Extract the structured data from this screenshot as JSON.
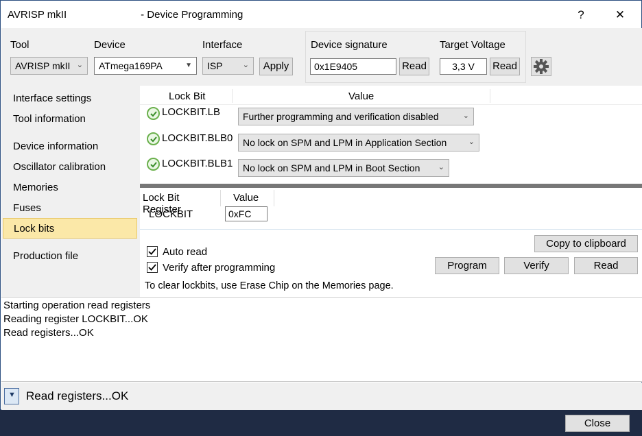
{
  "window": {
    "title_prefix": "AVRISP mkII",
    "title_suffix": "- Device Programming",
    "help": "?",
    "close": "✕"
  },
  "header": {
    "tool_label": "Tool",
    "tool_value": "AVRISP mkII",
    "device_label": "Device",
    "device_value": "ATmega169PA",
    "interface_label": "Interface",
    "interface_value": "ISP",
    "apply": "Apply",
    "signature_label": "Device signature",
    "signature_value": "0x1E9405",
    "signature_read": "Read",
    "voltage_label": "Target Voltage",
    "voltage_value": "3,3 V",
    "voltage_read": "Read"
  },
  "sidebar": {
    "items": [
      "Interface settings",
      "Tool information",
      "Device information",
      "Oscillator calibration",
      "Memories",
      "Fuses",
      "Lock bits",
      "Production file"
    ]
  },
  "lockbits": {
    "col_bit": "Lock Bit",
    "col_value": "Value",
    "rows": [
      {
        "name": "LOCKBIT.LB",
        "value": "Further programming and verification disabled"
      },
      {
        "name": "LOCKBIT.BLB0",
        "value": "No lock on SPM and LPM in Application Section"
      },
      {
        "name": "LOCKBIT.BLB1",
        "value": "No lock on SPM and LPM in Boot Section"
      }
    ]
  },
  "register": {
    "col_reg": "Lock Bit Register",
    "col_value": "Value",
    "name": "LOCKBIT",
    "value": "0xFC"
  },
  "options": {
    "auto_read": "Auto read",
    "verify": "Verify after programming",
    "hint": "To clear lockbits, use Erase Chip on the Memories page.",
    "copy": "Copy to clipboard",
    "program": "Program",
    "verify_btn": "Verify",
    "read": "Read"
  },
  "log": {
    "lines": [
      "Starting operation read registers",
      "Reading register LOCKBIT...OK",
      "Read registers...OK"
    ]
  },
  "status": {
    "text": "Read registers...OK"
  },
  "footer": {
    "close": "Close"
  }
}
